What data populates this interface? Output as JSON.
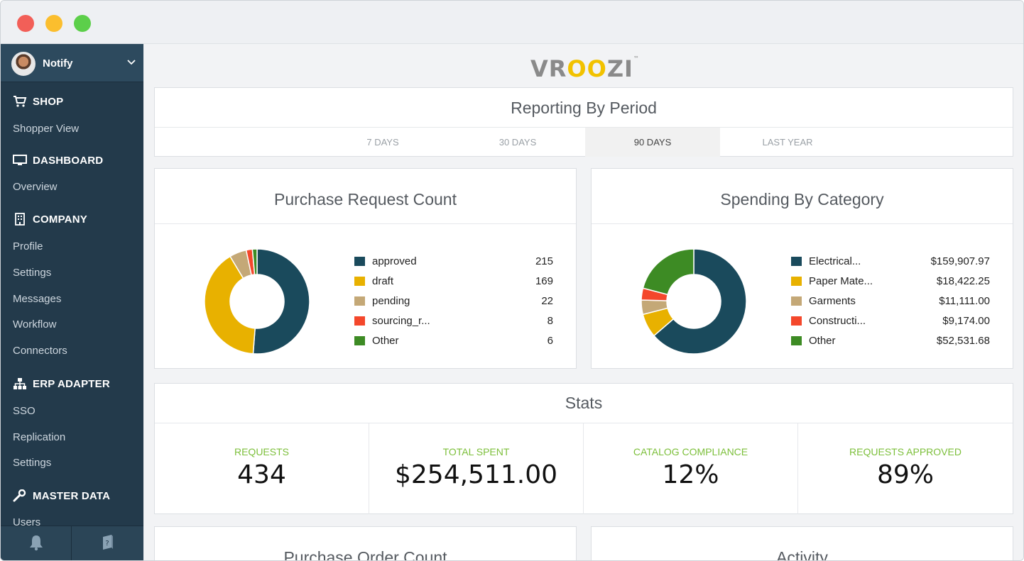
{
  "user": {
    "name": "Notify"
  },
  "sidebar": {
    "sections": [
      {
        "title": "SHOP",
        "icon": "cart-icon",
        "items": [
          "Shopper View"
        ]
      },
      {
        "title": "DASHBOARD",
        "icon": "monitor-icon",
        "items": [
          "Overview"
        ]
      },
      {
        "title": "COMPANY",
        "icon": "building-icon",
        "items": [
          "Profile",
          "Settings",
          "Messages",
          "Workflow",
          "Connectors"
        ]
      },
      {
        "title": "ERP ADAPTER",
        "icon": "sitemap-icon",
        "items": [
          "SSO",
          "Replication",
          "Settings"
        ]
      },
      {
        "title": "MASTER DATA",
        "icon": "wrench-icon",
        "items": [
          "Users"
        ]
      }
    ],
    "footer": {
      "left_icon": "bell-icon",
      "right_icon": "help-book-icon"
    }
  },
  "logo": {
    "text_a": "VR",
    "text_b": "OO",
    "text_c": "ZI",
    "tm": "™"
  },
  "reporting": {
    "title": "Reporting By Period",
    "tabs": [
      "7 DAYS",
      "30 DAYS",
      "90 DAYS",
      "LAST YEAR"
    ],
    "active_tab": "90 DAYS"
  },
  "purchase_requests": {
    "title": "Purchase Request Count",
    "legend": [
      {
        "label": "approved",
        "value": "215",
        "color": "#1a4a5c"
      },
      {
        "label": "draft",
        "value": "169",
        "color": "#e8b100"
      },
      {
        "label": "pending",
        "value": "22",
        "color": "#c4a877"
      },
      {
        "label": "sourcing_r...",
        "value": "8",
        "color": "#f4472b"
      },
      {
        "label": "Other",
        "value": "6",
        "color": "#3d8b24"
      }
    ]
  },
  "spending": {
    "title": "Spending By Category",
    "legend": [
      {
        "label": "Electrical...",
        "value": "$159,907.97",
        "color": "#1a4a5c"
      },
      {
        "label": "Paper Mate...",
        "value": "$18,422.25",
        "color": "#e8b100"
      },
      {
        "label": "Garments",
        "value": "$11,111.00",
        "color": "#c4a877"
      },
      {
        "label": "Constructi...",
        "value": "$9,174.00",
        "color": "#f4472b"
      },
      {
        "label": "Other",
        "value": "$52,531.68",
        "color": "#3d8b24"
      }
    ]
  },
  "stats": {
    "title": "Stats",
    "cells": [
      {
        "label": "REQUESTS",
        "value": "434"
      },
      {
        "label": "TOTAL SPENT",
        "value": "$254,511.00"
      },
      {
        "label": "CATALOG COMPLIANCE",
        "value": "12%"
      },
      {
        "label": "REQUESTS APPROVED",
        "value": "89%"
      }
    ]
  },
  "bottom_cards": {
    "left_title": "Purchase Order Count",
    "right_title": "Activity"
  },
  "chart_data": [
    {
      "type": "pie",
      "title": "Purchase Request Count",
      "categories": [
        "approved",
        "draft",
        "pending",
        "sourcing_r...",
        "Other"
      ],
      "values": [
        215,
        169,
        22,
        8,
        6
      ],
      "colors": [
        "#1a4a5c",
        "#e8b100",
        "#c4a877",
        "#f4472b",
        "#3d8b24"
      ],
      "donut": true
    },
    {
      "type": "pie",
      "title": "Spending By Category",
      "categories": [
        "Electrical...",
        "Paper Mate...",
        "Garments",
        "Constructi...",
        "Other"
      ],
      "values": [
        159907.97,
        18422.25,
        11111.0,
        9174.0,
        52531.68
      ],
      "colors": [
        "#1a4a5c",
        "#e8b100",
        "#c4a877",
        "#f4472b",
        "#3d8b24"
      ],
      "donut": true
    }
  ]
}
